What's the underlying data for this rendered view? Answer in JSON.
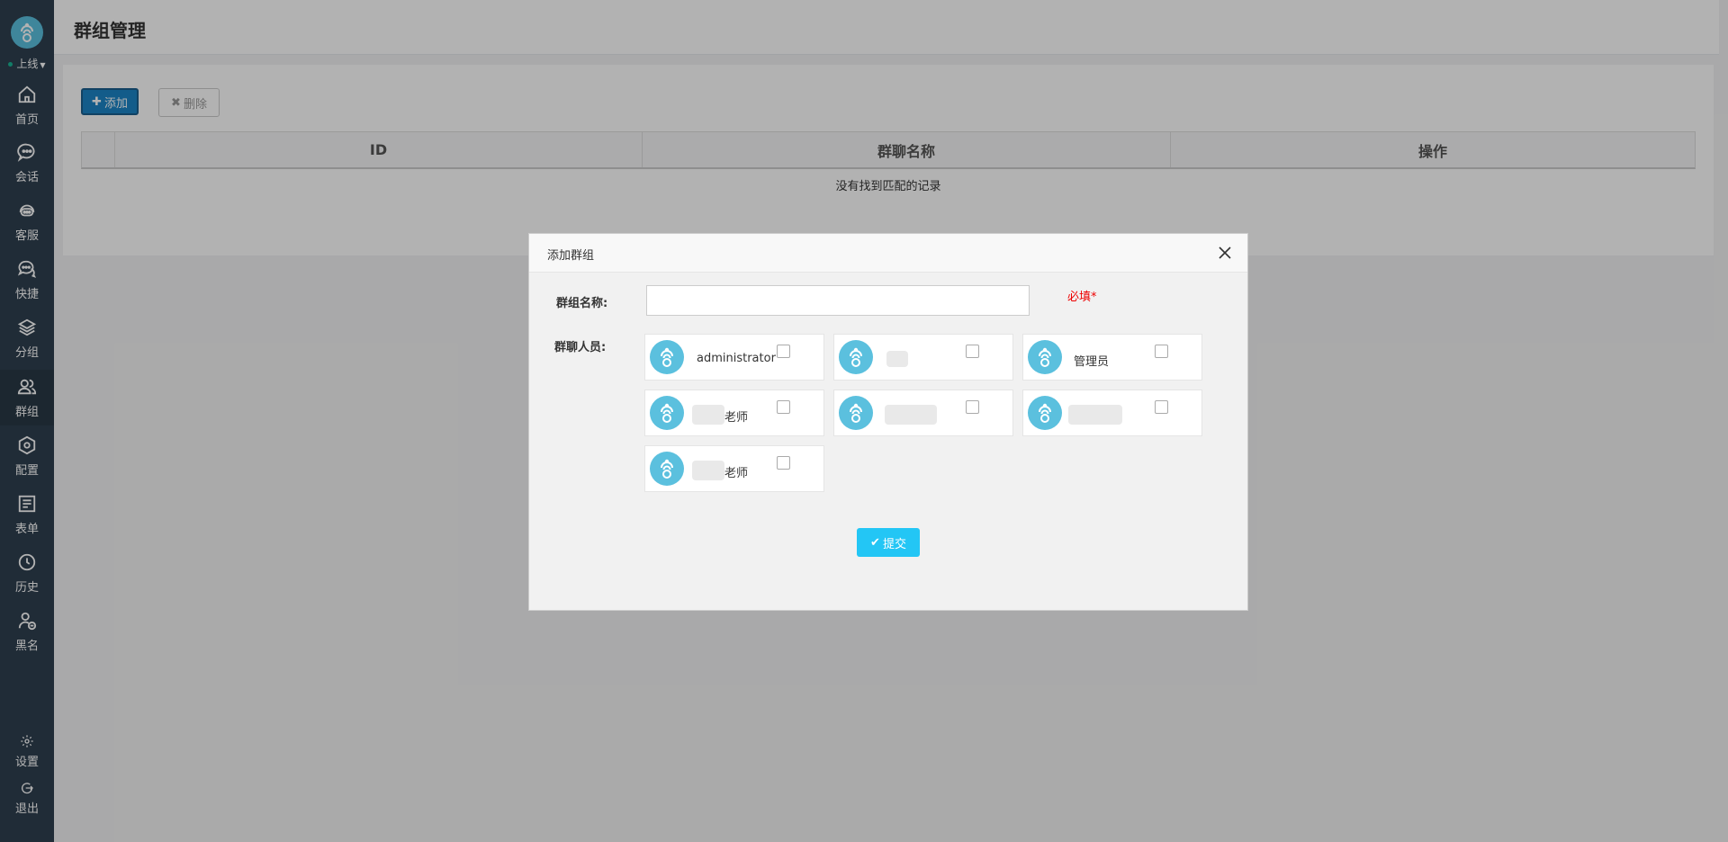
{
  "sidebar": {
    "status_label": "上线",
    "items": [
      {
        "label": "首页",
        "icon": "home-icon"
      },
      {
        "label": "会话",
        "icon": "chat-icon"
      },
      {
        "label": "客服",
        "icon": "service-icon"
      },
      {
        "label": "快捷",
        "icon": "quick-reply-icon"
      },
      {
        "label": "分组",
        "icon": "layers-icon"
      },
      {
        "label": "群组",
        "icon": "group-icon"
      },
      {
        "label": "配置",
        "icon": "hexagon-icon"
      },
      {
        "label": "表单",
        "icon": "form-icon"
      },
      {
        "label": "历史",
        "icon": "clock-icon"
      },
      {
        "label": "黑名",
        "icon": "user-block-icon"
      }
    ],
    "bottom": [
      {
        "label": "设置",
        "icon": "gear-icon"
      },
      {
        "label": "退出",
        "icon": "logout-icon"
      }
    ],
    "active_index": 5
  },
  "header": {
    "title": "群组管理"
  },
  "toolbar": {
    "add_label": "添加",
    "delete_label": "删除"
  },
  "table": {
    "columns": [
      "ID",
      "群聊名称",
      "操作"
    ],
    "empty_text": "没有找到匹配的记录"
  },
  "modal": {
    "title": "添加群组",
    "name_label": "群组名称:",
    "name_value": "",
    "required_label": "必填*",
    "members_label": "群聊人员:",
    "members": [
      {
        "name": "administrator"
      },
      {
        "name": ""
      },
      {
        "name": "管理员"
      },
      {
        "name": "老师"
      },
      {
        "name": ""
      },
      {
        "name": ""
      },
      {
        "name": "老师"
      }
    ],
    "submit_label": "提交"
  },
  "colors": {
    "sidebar_bg": "#2f4050",
    "primary": "#1c84c6",
    "submit": "#23c6f5",
    "avatar": "#5bc0de",
    "required": "#e00000"
  }
}
